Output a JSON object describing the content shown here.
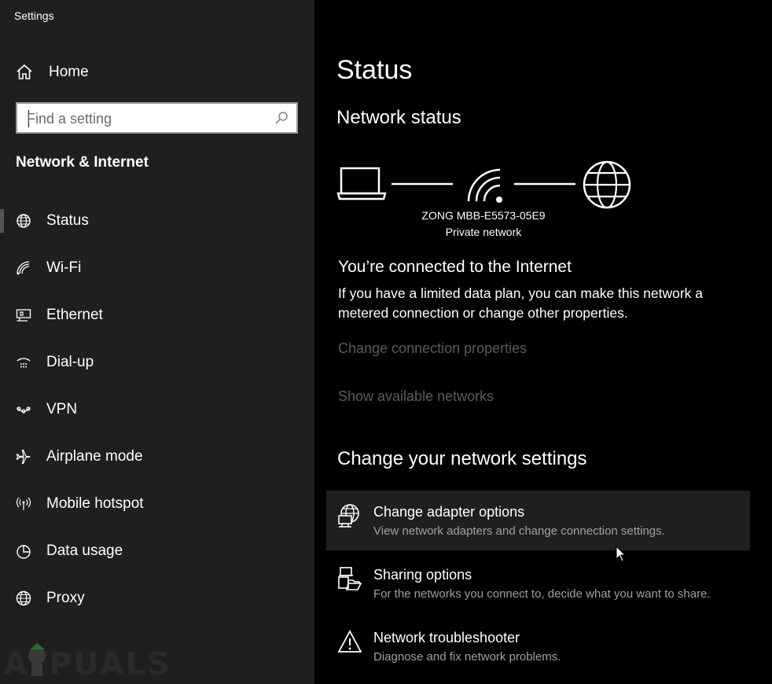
{
  "window": {
    "title": "Settings"
  },
  "sidebar": {
    "home_label": "Home",
    "search_placeholder": "Find a setting",
    "section_title": "Network & Internet",
    "items": [
      {
        "label": "Status",
        "icon": "globe-status-icon"
      },
      {
        "label": "Wi-Fi",
        "icon": "wifi-icon"
      },
      {
        "label": "Ethernet",
        "icon": "ethernet-icon"
      },
      {
        "label": "Dial-up",
        "icon": "dialup-icon"
      },
      {
        "label": "VPN",
        "icon": "vpn-icon"
      },
      {
        "label": "Airplane mode",
        "icon": "airplane-icon"
      },
      {
        "label": "Mobile hotspot",
        "icon": "hotspot-icon"
      },
      {
        "label": "Data usage",
        "icon": "pie-chart-icon"
      },
      {
        "label": "Proxy",
        "icon": "globe-icon"
      }
    ],
    "active_item": "Status",
    "watermark": "A PUALS"
  },
  "main": {
    "title": "Status",
    "network_status_heading": "Network status",
    "network_name": "ZONG MBB-E5573-05E9",
    "network_type": "Private network",
    "connected_title": "You’re connected to the Internet",
    "connected_desc": "If you have a limited data plan, you can make this network a metered connection or change other properties.",
    "link_change_properties": "Change connection properties",
    "link_show_networks": "Show available networks",
    "change_settings_heading": "Change your network settings",
    "options": [
      {
        "title": "Change adapter options",
        "desc": "View network adapters and change connection settings.",
        "icon": "adapter-icon"
      },
      {
        "title": "Sharing options",
        "desc": "For the networks you connect to, decide what you want to share.",
        "icon": "sharing-icon"
      },
      {
        "title": "Network troubleshooter",
        "desc": "Diagnose and fix network problems.",
        "icon": "warning-icon"
      }
    ]
  },
  "colors": {
    "sidebar_bg": "#1f1f1f",
    "main_bg": "#000000",
    "disabled_link": "#5b5b5b",
    "hover_bg": "#1f1f1f"
  }
}
